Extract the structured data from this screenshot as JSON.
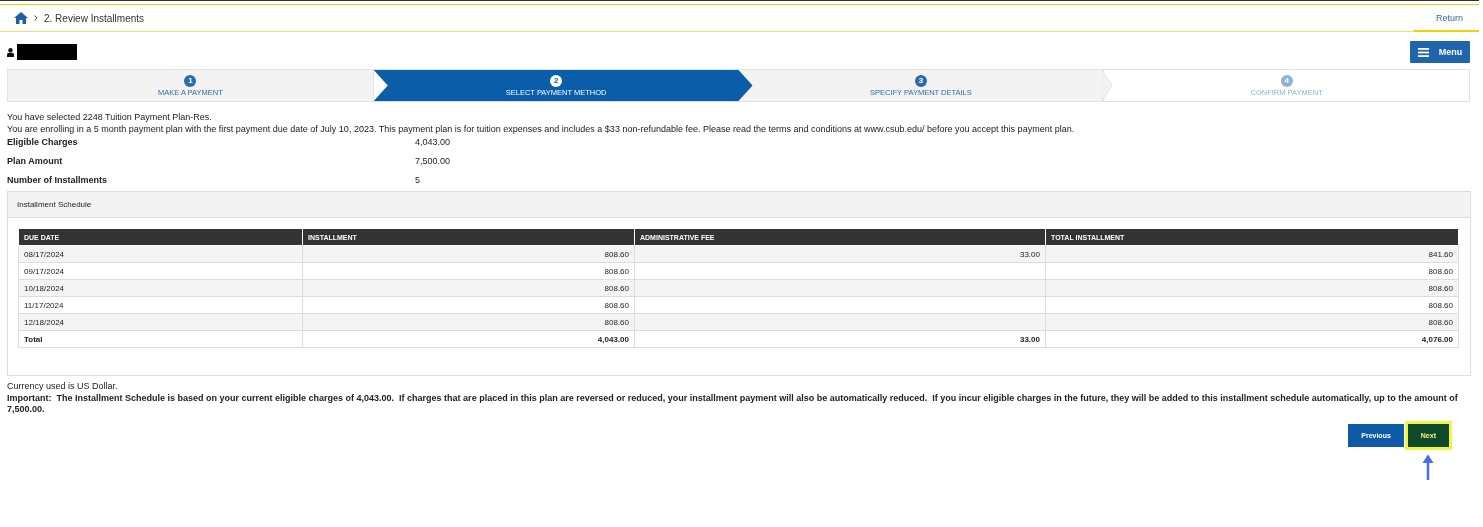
{
  "breadcrumb": {
    "current": "2. Review Installments"
  },
  "return_link": "Return",
  "menu_button": "Menu",
  "steps": [
    {
      "number": "1",
      "label": "MAKE A PAYMENT",
      "selected": false,
      "disabled": false
    },
    {
      "number": "2",
      "label": "SELECT PAYMENT METHOD",
      "selected": true,
      "disabled": false
    },
    {
      "number": "3",
      "label": "SPECIFY PAYMENT DETAILS",
      "selected": false,
      "disabled": false
    },
    {
      "number": "4",
      "label": "CONFIRM PAYMENT",
      "selected": false,
      "disabled": true
    }
  ],
  "intro": [
    "You have selected 2248 Tuition Payment Plan-Res.",
    "You are enrolling in a 5 month payment plan with the first payment due date of July 10, 2023. This payment plan is for tuition expenses and includes a $33 non-refundable fee. Please read the terms and conditions at www.csub.edu/ before you accept this payment plan."
  ],
  "summary": [
    {
      "label": "Eligible Charges",
      "value": "4,043.00"
    },
    {
      "label": "Plan Amount",
      "value": "7,500.00"
    },
    {
      "label": "Number of Installments",
      "value": "5"
    }
  ],
  "schedule": {
    "title": "Installment Schedule",
    "columns": [
      "DUE DATE",
      "INSTALLMENT",
      "ADMINISTRATIVE FEE",
      "TOTAL INSTALLMENT"
    ],
    "rows": [
      [
        "08/17/2024",
        "808.60",
        "33.00",
        "841.60"
      ],
      [
        "09/17/2024",
        "808.60",
        "",
        "808.60"
      ],
      [
        "10/18/2024",
        "808.60",
        "",
        "808.60"
      ],
      [
        "11/17/2024",
        "808.60",
        "",
        "808.60"
      ],
      [
        "12/18/2024",
        "808.60",
        "",
        "808.60"
      ]
    ],
    "total": [
      "Total",
      "4,043.00",
      "33.00",
      "4,076.00"
    ]
  },
  "currency_note": "Currency used is US Dollar.",
  "important_note": "**Important:  The Installment Schedule is based on your current eligible charges of 4,043.00.  If charges that are placed in this plan are reversed or reduced, your installment payment will also be automatically reduced.  If you incur eligible charges in the future, they will be added to this installment schedule automatically, up to the amount of 7,500.00.**",
  "buttons": [
    {
      "label": "Previous",
      "kind": "secondary",
      "highlighted": false
    },
    {
      "label": "Next",
      "kind": "primary",
      "highlighted": true
    }
  ]
}
